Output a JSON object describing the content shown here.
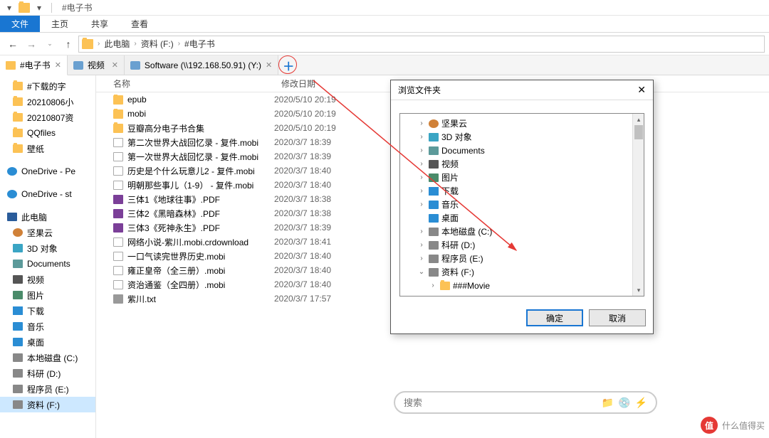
{
  "window": {
    "title": "#电子书"
  },
  "ribbon": {
    "file": "文件",
    "home": "主页",
    "share": "共享",
    "view": "查看"
  },
  "breadcrumbs": [
    "此电脑",
    "资料 (F:)",
    "#电子书"
  ],
  "tabs": [
    {
      "label": "#电子书",
      "active": true,
      "icon": "folder"
    },
    {
      "label": "视频",
      "active": false,
      "icon": "disk"
    },
    {
      "label": "Software (\\\\192.168.50.91) (Y:)",
      "active": false,
      "icon": "disk"
    }
  ],
  "sidebar": {
    "groups": [
      {
        "items": [
          {
            "label": "#下载的字",
            "icon": "si-folder"
          },
          {
            "label": "20210806小",
            "icon": "si-folder"
          },
          {
            "label": "20210807资",
            "icon": "si-folder"
          },
          {
            "label": "QQfiles",
            "icon": "si-folder"
          },
          {
            "label": "壁纸",
            "icon": "si-folder"
          }
        ]
      },
      {
        "items": [
          {
            "label": "OneDrive - Pe",
            "icon": "si-onedrive",
            "grp": true
          }
        ]
      },
      {
        "items": [
          {
            "label": "OneDrive - st",
            "icon": "si-onedrive",
            "grp": true
          }
        ]
      },
      {
        "items": [
          {
            "label": "此电脑",
            "icon": "si-pc",
            "grp": true
          },
          {
            "label": "坚果云",
            "icon": "si-nut"
          },
          {
            "label": "3D 对象",
            "icon": "si-3d"
          },
          {
            "label": "Documents",
            "icon": "si-doc"
          },
          {
            "label": "视频",
            "icon": "si-vid"
          },
          {
            "label": "图片",
            "icon": "si-pic"
          },
          {
            "label": "下载",
            "icon": "si-down"
          },
          {
            "label": "音乐",
            "icon": "si-music"
          },
          {
            "label": "桌面",
            "icon": "si-desk"
          },
          {
            "label": "本地磁盘 (C:)",
            "icon": "si-disk"
          },
          {
            "label": "科研 (D:)",
            "icon": "si-disk"
          },
          {
            "label": "程序员 (E:)",
            "icon": "si-disk"
          },
          {
            "label": "资料 (F:)",
            "icon": "si-disk",
            "selected": true
          }
        ]
      }
    ]
  },
  "columns": {
    "name": "名称",
    "date": "修改日期"
  },
  "files": [
    {
      "name": "epub",
      "date": "2020/5/10 20:19",
      "icon": "fi-folder"
    },
    {
      "name": "mobi",
      "date": "2020/5/10 20:19",
      "icon": "fi-folder"
    },
    {
      "name": "豆瓣高分电子书合集",
      "date": "2020/5/10 20:19",
      "icon": "fi-folder"
    },
    {
      "name": "第二次世界大战回忆录 - 复件.mobi",
      "date": "2020/3/7 18:39",
      "icon": "fi-file"
    },
    {
      "name": "第一次世界大战回忆录 - 复件.mobi",
      "date": "2020/3/7 18:39",
      "icon": "fi-file"
    },
    {
      "name": "历史是个什么玩意儿2 - 复件.mobi",
      "date": "2020/3/7 18:40",
      "icon": "fi-file"
    },
    {
      "name": "明朝那些事儿（1-9） - 复件.mobi",
      "date": "2020/3/7 18:40",
      "icon": "fi-file"
    },
    {
      "name": "三体1《地球往事》.PDF",
      "date": "2020/3/7 18:38",
      "icon": "fi-pdf"
    },
    {
      "name": "三体2《黑暗森林》.PDF",
      "date": "2020/3/7 18:38",
      "icon": "fi-pdf"
    },
    {
      "name": "三体3《死神永生》.PDF",
      "date": "2020/3/7 18:39",
      "icon": "fi-pdf"
    },
    {
      "name": "网络小说-紫川.mobi.crdownload",
      "date": "2020/3/7 18:41",
      "icon": "fi-file"
    },
    {
      "name": "一口气读完世界历史.mobi",
      "date": "2020/3/7 18:40",
      "icon": "fi-file"
    },
    {
      "name": "雍正皇帝（全三册）.mobi",
      "date": "2020/3/7 18:40",
      "icon": "fi-file"
    },
    {
      "name": "资治通鉴（全四册）.mobi",
      "date": "2020/3/7 18:40",
      "icon": "fi-file"
    },
    {
      "name": "紫川.txt",
      "date": "2020/3/7 17:57",
      "icon": "fi-txt"
    }
  ],
  "dialog": {
    "title": "浏览文件夹",
    "ok": "确定",
    "cancel": "取消",
    "tree": [
      {
        "exp": "›",
        "label": "坚果云",
        "icon": "si-nut",
        "indent": 1
      },
      {
        "exp": "›",
        "label": "3D 对象",
        "icon": "si-3d",
        "indent": 1
      },
      {
        "exp": "›",
        "label": "Documents",
        "icon": "si-doc",
        "indent": 1
      },
      {
        "exp": "›",
        "label": "视频",
        "icon": "si-vid",
        "indent": 1
      },
      {
        "exp": "›",
        "label": "图片",
        "icon": "si-pic",
        "indent": 1
      },
      {
        "exp": "›",
        "label": "下载",
        "icon": "si-down",
        "indent": 1
      },
      {
        "exp": "›",
        "label": "音乐",
        "icon": "si-music",
        "indent": 1
      },
      {
        "exp": "",
        "label": "桌面",
        "icon": "si-desk",
        "indent": 1
      },
      {
        "exp": "›",
        "label": "本地磁盘 (C:)",
        "icon": "si-disk",
        "indent": 1
      },
      {
        "exp": "›",
        "label": "科研 (D:)",
        "icon": "si-disk",
        "indent": 1
      },
      {
        "exp": "›",
        "label": "程序员 (E:)",
        "icon": "si-disk",
        "indent": 1
      },
      {
        "exp": "⌄",
        "label": "资料 (F:)",
        "icon": "si-disk",
        "indent": 1
      },
      {
        "exp": "›",
        "label": "###Movie",
        "icon": "si-folder",
        "indent": 2
      }
    ]
  },
  "search": {
    "placeholder": "搜索"
  },
  "watermark": {
    "text": "什么值得买"
  }
}
